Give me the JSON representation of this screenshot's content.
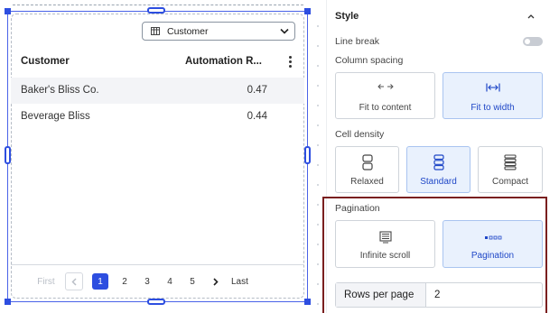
{
  "table_widget": {
    "column_select": {
      "icon": "table-grid-icon",
      "value": "Customer"
    },
    "headers": [
      "Customer",
      "Automation R..."
    ],
    "rows": [
      {
        "customer": "Baker's Bliss Co.",
        "automation_rate": "0.47"
      },
      {
        "customer": "Beverage Bliss",
        "automation_rate": "0.44"
      }
    ],
    "pager": {
      "first": "First",
      "prev_icon": "chevron-left-icon",
      "pages": [
        "1",
        "2",
        "3",
        "4",
        "5"
      ],
      "active_page": "1",
      "next_icon": "chevron-right-icon",
      "last": "Last"
    }
  },
  "style_panel": {
    "title": "Style",
    "line_break_label": "Line break",
    "column_spacing_label": "Column spacing",
    "column_spacing_options": [
      "Fit to content",
      "Fit to width"
    ],
    "column_spacing_selected": "Fit to width",
    "cell_density_label": "Cell density",
    "cell_density_options": [
      "Relaxed",
      "Standard",
      "Compact"
    ],
    "cell_density_selected": "Standard",
    "pagination_label": "Pagination",
    "pagination_options": [
      "Infinite scroll",
      "Pagination"
    ],
    "pagination_selected": "Pagination",
    "rows_per_page_label": "Rows per page",
    "rows_per_page_value": "2"
  },
  "colors": {
    "selection_blue": "#2d4ee0",
    "selected_option_bg": "#e9f1fd",
    "highlight_border": "#7a1f1f"
  }
}
